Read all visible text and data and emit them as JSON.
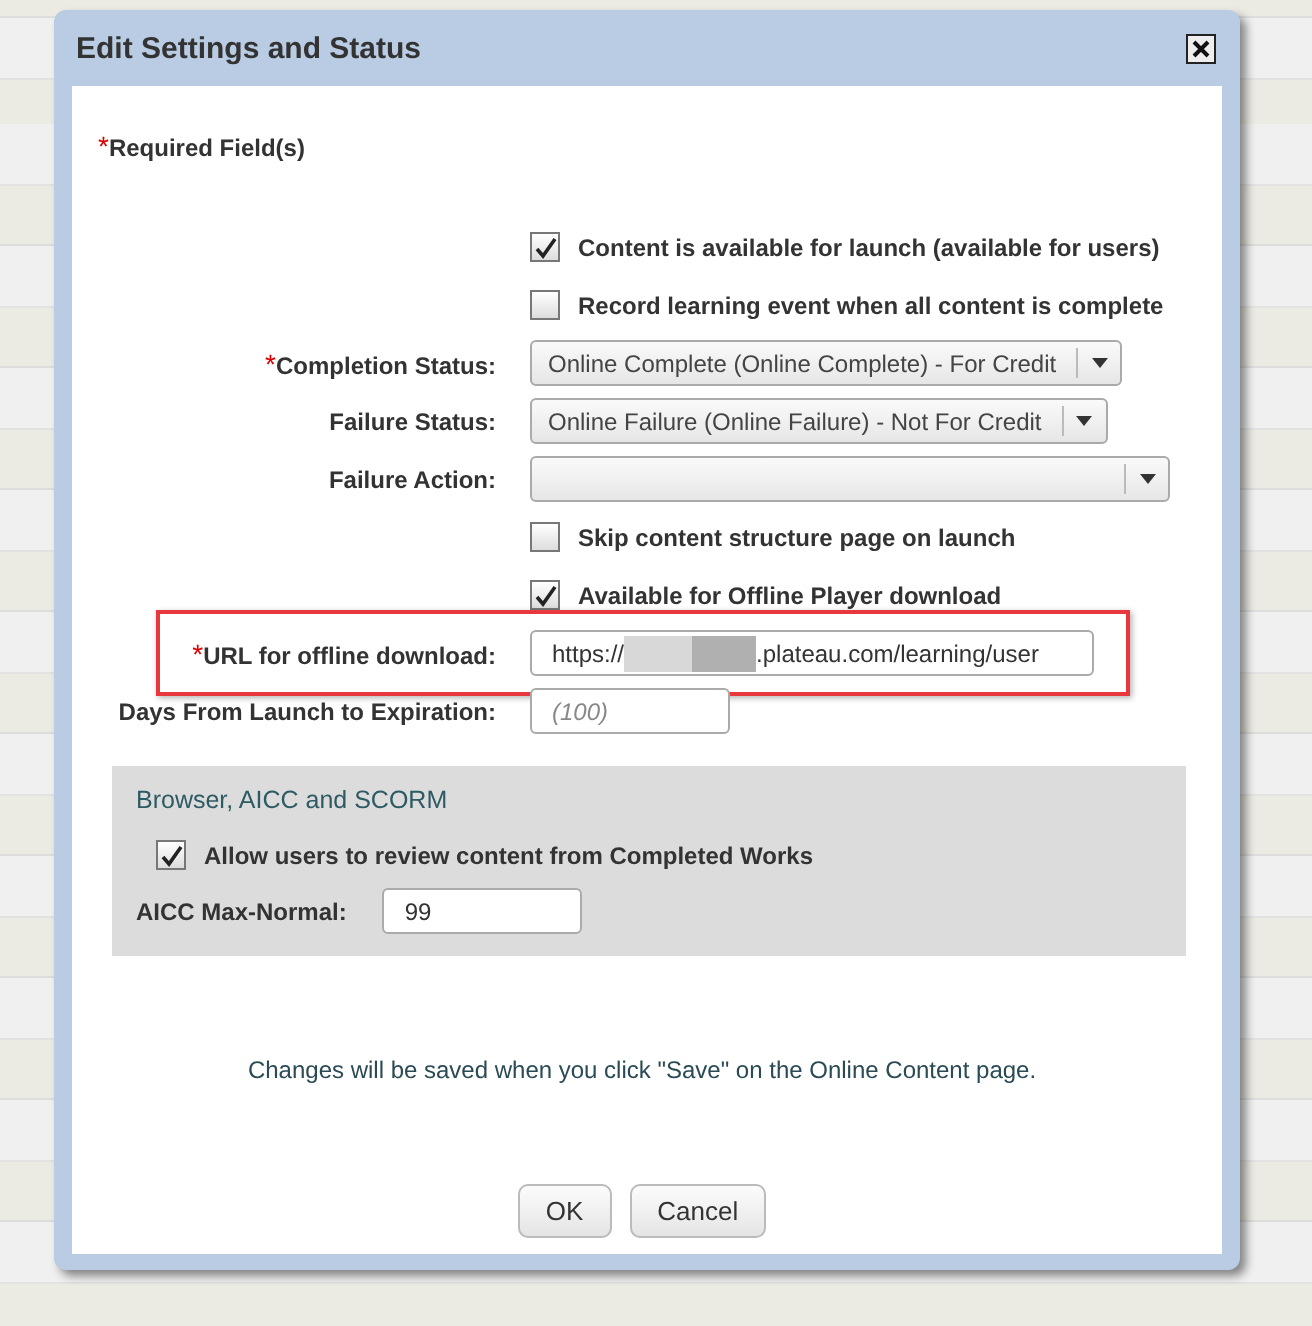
{
  "dialog": {
    "title": "Edit Settings and Status",
    "required_note": {
      "mark": "*",
      "text": "Required Field(s)"
    },
    "fields": [
      {
        "kind": "checkbox",
        "text": "Content is available for launch (available for users)",
        "checked": true
      },
      {
        "kind": "checkbox",
        "text": "Record learning event when all content is complete",
        "checked": false
      },
      {
        "kind": "select",
        "label": "Completion Status:",
        "required_mark": "*",
        "value": "Online Complete (Online Complete) - For Credit"
      },
      {
        "kind": "select",
        "label": "Failure Status:",
        "value": "Online Failure (Online Failure) - Not For Credit"
      },
      {
        "kind": "select",
        "label": "Failure Action:"
      },
      {
        "kind": "checkbox",
        "text": "Skip content structure page on launch",
        "checked": false
      },
      {
        "kind": "checkbox",
        "text": "Available for Offline Player download",
        "checked": true
      },
      {
        "kind": "url",
        "label": "URL for offline download:",
        "required_mark": "*",
        "value_start": "https://",
        "value_end": ".plateau.com/learning/user",
        "highlighted": true
      },
      {
        "kind": "text",
        "label": "Days From Launch to Expiration:",
        "placeholder": "(100)"
      }
    ],
    "section": {
      "title": "Browser, AICC and SCORM",
      "checkbox": {
        "text": "Allow users to review content from Completed Works",
        "checked": true
      },
      "field": {
        "label": "AICC Max-Normal:",
        "value": "99"
      }
    },
    "message": "Changes will be saved when you click \"Save\" on the Online Content page.",
    "buttons": [
      "OK",
      "Cancel"
    ]
  }
}
